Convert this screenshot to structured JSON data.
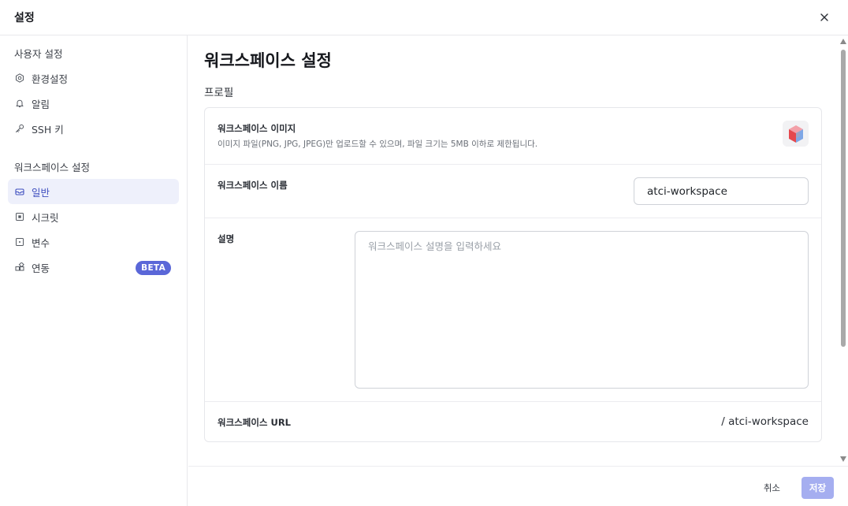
{
  "dialog": {
    "title": "설정",
    "close_icon": "close-icon"
  },
  "sidebar": {
    "user_section": "사용자 설정",
    "user_items": [
      {
        "label": "환경설정",
        "icon": "gear-icon"
      },
      {
        "label": "알림",
        "icon": "bell-icon"
      },
      {
        "label": "SSH 키",
        "icon": "key-icon"
      }
    ],
    "workspace_section": "워크스페이스 설정",
    "workspace_items": [
      {
        "label": "일반",
        "icon": "inbox-icon",
        "active": true
      },
      {
        "label": "시크릿",
        "icon": "secret-box-icon"
      },
      {
        "label": "변수",
        "icon": "variable-box-icon"
      },
      {
        "label": "연동",
        "icon": "integration-icon",
        "badge": "BETA"
      }
    ]
  },
  "main": {
    "title": "워크스페이스 설정",
    "profile_heading": "프로필",
    "image_label": "워크스페이스 이미지",
    "image_desc": "이미지 파일(PNG, JPG, JPEG)만 업로드할 수 있으며, 파일 크기는 5MB 이하로 제한됩니다.",
    "name_label": "워크스페이스 이름",
    "name_value": "atci-workspace",
    "desc_label": "설명",
    "desc_placeholder": "워크스페이스 설명을 입력하세요",
    "url_label": "워크스페이스 URL",
    "url_value": "/ atci-workspace"
  },
  "footer": {
    "cancel_label": "취소",
    "save_label": "저장"
  },
  "colors": {
    "accent": "#5a67d8",
    "save_disabled": "#a5aef0",
    "active_bg": "#eef0fb",
    "danger": "#e5484d"
  }
}
